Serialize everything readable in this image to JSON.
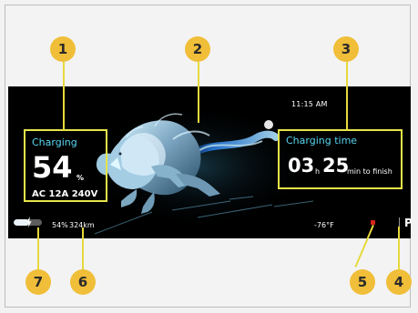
{
  "screen": {
    "charging": {
      "label": "Charging",
      "percent": "54",
      "percent_unit": "%",
      "power": "AC  12A 240V"
    },
    "charging_time": {
      "label": "Charging time",
      "hours": "03",
      "hours_unit": "h",
      "minutes": "25",
      "minutes_unit": "min to finish"
    },
    "clock": "11:15 AM",
    "battery": {
      "percent_text": "54%",
      "level_percent": 54
    },
    "range": "324km",
    "temperature": "-76°F",
    "gear": "P"
  },
  "callouts": [
    "1",
    "2",
    "3",
    "4",
    "5",
    "6",
    "7"
  ],
  "colors": {
    "accent": "#58d6f2",
    "callout": "#f0be38",
    "highlight_box": "#e6e54a",
    "warning": "#d6261c",
    "screen_bg": "#000000"
  }
}
